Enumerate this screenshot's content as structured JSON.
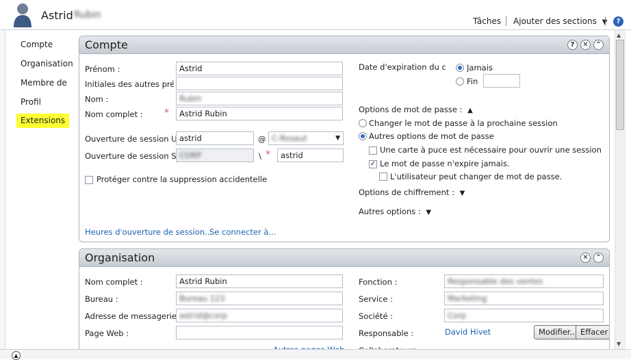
{
  "header": {
    "user_first": "Astrid",
    "user_last": "Rubin",
    "tasks": "Tâches",
    "add_sections": "Ajouter des sections",
    "help": "?"
  },
  "nav": {
    "items": [
      "Compte",
      "Organisation",
      "Membre de",
      "Profil",
      "Extensions"
    ],
    "active": "Extensions"
  },
  "compte": {
    "title": "Compte",
    "first_name_label": "Prénom :",
    "first_name_value": "Astrid",
    "initials_label": "Initiales des autres pré...",
    "initials_value": "",
    "last_name_label": "Nom :",
    "last_name_value": "Rubin",
    "full_name_label": "Nom complet :",
    "full_name_value": "Astrid Rubin",
    "logon_label": "Ouverture de session U...",
    "logon_value": "astrid",
    "at": "@",
    "domain_value": "C-Rosaut",
    "logon_pre_label": "Ouverture de session S...",
    "logon_pre_value": "CORP",
    "backslash": "\\",
    "logon_pre_user": "astrid",
    "protect_label": "Protéger contre la suppression accidentelle",
    "expiry_label": "Date d'expiration du co",
    "never": "Jamais",
    "end": "Fin",
    "pw_options_label": "Options de mot de passe :",
    "pw_change_next": "Changer le mot de passe à la prochaine session",
    "pw_other": "Autres options de mot de passe",
    "smartcard": "Une carte à puce est nécessaire pour ouvrir une session int...",
    "never_expires": "Le mot de passe n'expire jamais.",
    "cannot_change": "L'utilisateur peut changer de mot de passe.",
    "encryption": "Options de chiffrement :",
    "other_options": "Autres options :",
    "logon_hours": "Heures d'ouverture de session...",
    "logon_to": "Se connecter à...",
    "btn_help": "?",
    "btn_close": "✕",
    "btn_collapse": "⌃"
  },
  "organisation": {
    "title": "Organisation",
    "full_name_label": "Nom complet :",
    "full_name_value": "Astrid Rubin",
    "office_label": "Bureau :",
    "office_value": "Bureau 123",
    "email_label": "Adresse de messagerie :",
    "email_value": "astrid@corp",
    "web_label": "Page Web :",
    "web_value": "",
    "other_web": "Autres pages Web",
    "job_label": "Fonction :",
    "job_value": "Responsable des ventes",
    "dept_label": "Service :",
    "dept_value": "Marketing",
    "company_label": "Société :",
    "company_value": "Corp",
    "manager_label": "Responsable :",
    "manager_value": "David Hivet",
    "modify": "Modifier...",
    "clear": "Effacer",
    "reports_label": "Collaborateurs :",
    "btn_close": "✕",
    "btn_collapse": "⌃"
  },
  "colors": {
    "accent": "#1d5fb0",
    "highlight": "#ffff33",
    "required": "#e05050"
  }
}
